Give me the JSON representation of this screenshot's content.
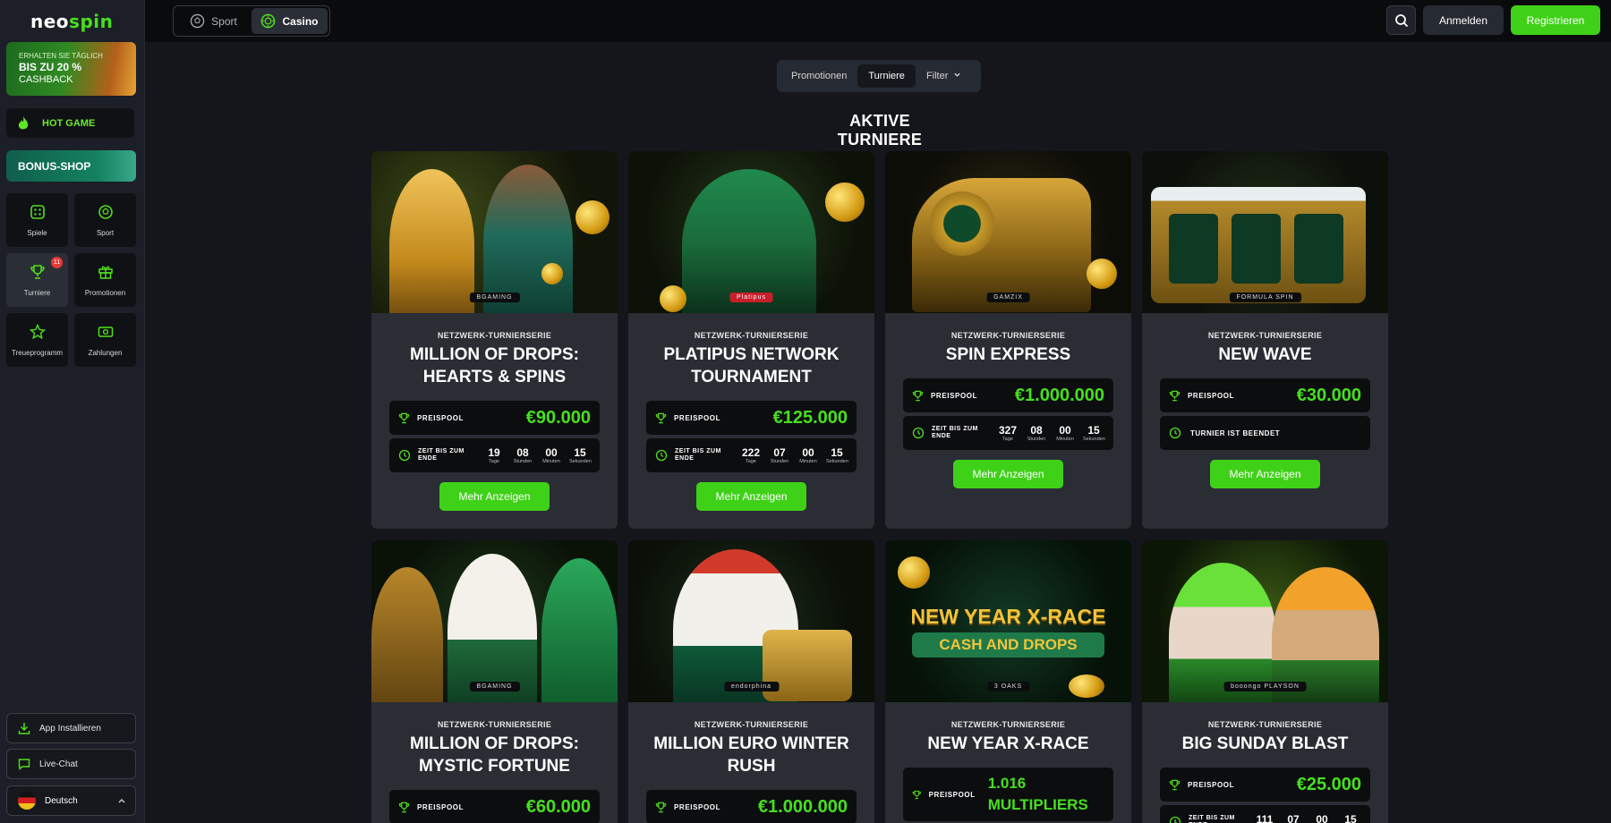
{
  "brand": {
    "logo_prefix": "neo",
    "logo_accent": "spin"
  },
  "sidebar": {
    "cashback": {
      "line1": "ERHALTEN SIE TÄGLICH",
      "line2": "BIS ZU 20 %",
      "line3": "CASHBACK"
    },
    "hot_game": "HOT GAME",
    "bonus_shop": "BONUS-SHOP",
    "nav": [
      {
        "label": "Spiele",
        "icon": "dice-icon"
      },
      {
        "label": "Sport",
        "icon": "soccer-ball-icon"
      },
      {
        "label": "Turniere",
        "icon": "trophy-icon",
        "badge": "11",
        "active": true
      },
      {
        "label": "Promotionen",
        "icon": "gift-icon"
      },
      {
        "label": "Treueprogramm",
        "icon": "star-icon"
      },
      {
        "label": "Zahlungen",
        "icon": "cash-icon"
      }
    ],
    "install_app": "App Installieren",
    "live_chat": "Live-Chat",
    "language": "Deutsch"
  },
  "topbar": {
    "sport": "Sport",
    "casino": "Casino",
    "login": "Anmelden",
    "register": "Registrieren"
  },
  "tabs": {
    "promotions": "Promotionen",
    "tournaments": "Turniere",
    "filter": "Filter"
  },
  "heading": "AKTIVE TURNIERE",
  "labels": {
    "series": "NETZWERK-TURNIERSERIE",
    "prize_pool": "PREISPOOL",
    "time_left": "ZEIT BIS ZUM ENDE",
    "ended": "TURNIER IST BEENDET",
    "more": "Mehr Anzeigen",
    "days": "Tage",
    "hours": "Stunden",
    "minutes": "Minuten",
    "seconds": "Sekunden"
  },
  "cards": [
    {
      "title": "MILLION OF DROPS: HEARTS & SPINS",
      "pool": "€90.000",
      "d": "19",
      "h": "08",
      "m": "00",
      "s": "15",
      "provider": "BGAMING"
    },
    {
      "title": "PLATIPUS NETWORK TOURNAMENT",
      "pool": "€125.000",
      "d": "222",
      "h": "07",
      "m": "00",
      "s": "15",
      "provider": "Platipus"
    },
    {
      "title": "SPIN EXPRESS",
      "pool": "€1.000.000",
      "d": "327",
      "h": "08",
      "m": "00",
      "s": "15",
      "provider": "GAMZIX"
    },
    {
      "title": "NEW WAVE",
      "pool": "€30.000",
      "provider": "FORMULA SPIN"
    },
    {
      "title": "MILLION OF DROPS: MYSTIC FORTUNE",
      "pool": "€60.000",
      "provider": "BGAMING"
    },
    {
      "title": "MILLION EURO WINTER RUSH",
      "pool": "€1.000.000",
      "provider": "endorphina"
    },
    {
      "title": "NEW YEAR X-RACE",
      "pool": "1.016 MULTIPLIERS",
      "provider": "3 OAKS",
      "art_text1": "NEW YEAR X-RACE",
      "art_text2": "CASH AND DROPS"
    },
    {
      "title": "BIG SUNDAY BLAST",
      "pool": "€25.000",
      "d": "111",
      "h": "07",
      "m": "00",
      "s": "15",
      "provider": "booongo PLAYSON"
    }
  ],
  "colors": {
    "accent": "#3fd118",
    "pool_value": "#46e01e",
    "bg": "#14161c",
    "card": "#2a2d34"
  }
}
